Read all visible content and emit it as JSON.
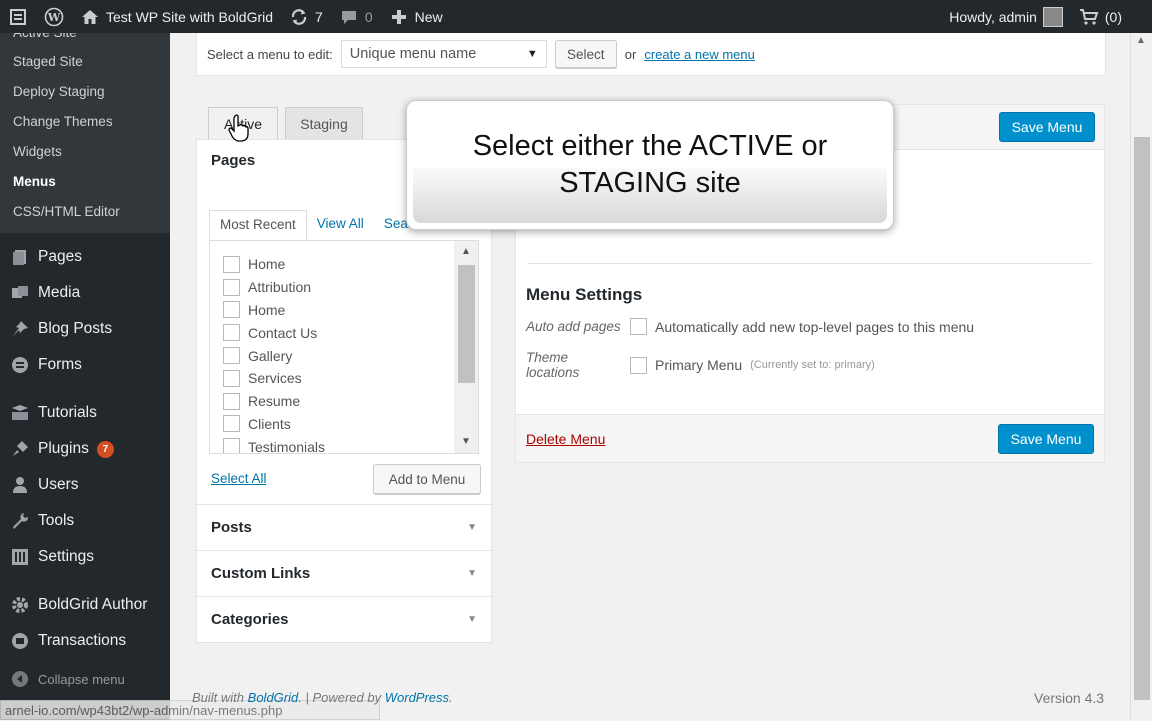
{
  "adminbar": {
    "site_name": "Test WP Site with BoldGrid",
    "updates_count": "7",
    "comments_count": "0",
    "new_label": "New",
    "howdy": "Howdy, admin",
    "cart_label": "(0)",
    "icons": [
      "dashboard-icon",
      "wordpress-icon",
      "home-icon",
      "refresh-icon",
      "comment-icon",
      "plus-icon",
      "cart-icon"
    ]
  },
  "sidebar": {
    "submenu": [
      "Active Site",
      "Staged Site",
      "Deploy Staging",
      "Change Themes",
      "Widgets",
      "Menus",
      "CSS/HTML Editor"
    ],
    "items": [
      {
        "label": "Pages",
        "icon": "pages-icon"
      },
      {
        "label": "Media",
        "icon": "media-icon"
      },
      {
        "label": "Blog Posts",
        "icon": "pin-icon"
      },
      {
        "label": "Forms",
        "icon": "forms-icon"
      },
      {
        "label": "Tutorials",
        "icon": "tutorials-icon"
      },
      {
        "label": "Plugins",
        "icon": "plugins-icon",
        "badge": "7"
      },
      {
        "label": "Users",
        "icon": "users-icon"
      },
      {
        "label": "Tools",
        "icon": "tools-icon"
      },
      {
        "label": "Settings",
        "icon": "settings-icon"
      },
      {
        "label": "BoldGrid Author",
        "icon": "gear-icon"
      },
      {
        "label": "Transactions",
        "icon": "transactions-icon"
      }
    ],
    "collapse": "Collapse menu"
  },
  "status_url": "arnel-io.com/wp43bt2/wp-admin/nav-menus.php",
  "menu_select": {
    "prompt": "Select a menu to edit:",
    "selected": "Unique menu name",
    "select_button": "Select",
    "or_text": "or",
    "create_link": "create a new menu"
  },
  "tabs": {
    "active": "Active",
    "staging": "Staging"
  },
  "pages_box": {
    "title": "Pages",
    "tabs": [
      "Most Recent",
      "View All",
      "Search"
    ],
    "items": [
      "Home",
      "Attribution",
      "Home",
      "Contact Us",
      "Gallery",
      "Services",
      "Resume",
      "Clients",
      "Testimonials"
    ],
    "select_all": "Select All",
    "add_button": "Add to Menu"
  },
  "accordions": [
    "Posts",
    "Custom Links",
    "Categories"
  ],
  "menu_panel": {
    "save_label": "Save Menu",
    "settings_title": "Menu Settings",
    "auto_add_label": "Auto add pages",
    "auto_add_text": "Automatically add new top-level pages to this menu",
    "theme_locations_label": "Theme locations",
    "primary_menu_text": "Primary Menu",
    "primary_note": "(Currently set to: primary)",
    "delete_label": "Delete Menu"
  },
  "tooltip": "Select either the ACTIVE or STAGING site",
  "footer": {
    "built_with": "Built with",
    "boldgrid": "BoldGrid",
    "sep": ". | Powered by",
    "wordpress": "WordPress",
    "period": ".",
    "version": "Version 4.3"
  },
  "colors": {
    "admin_bar": "#23282d",
    "accent": "#0091cd",
    "badge": "#d54e21",
    "delete": "#aa0000"
  }
}
